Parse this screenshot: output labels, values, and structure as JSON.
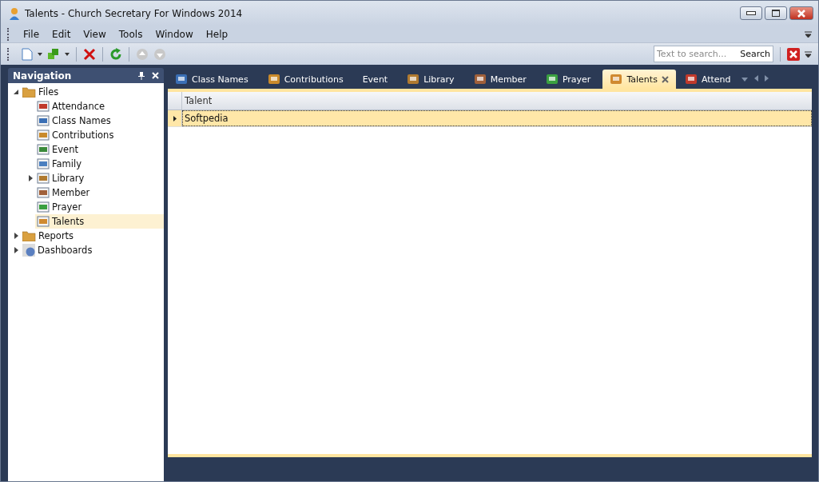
{
  "window": {
    "title": "Talents - Church Secretary For Windows 2014"
  },
  "menu": [
    "File",
    "Edit",
    "View",
    "Tools",
    "Window",
    "Help"
  ],
  "search": {
    "placeholder": "Text to search...",
    "button": "Search"
  },
  "navigation": {
    "title": "Navigation",
    "items": [
      {
        "label": "Files",
        "expanded": true,
        "selected": false,
        "children": [
          {
            "label": "Attendance",
            "selected": false
          },
          {
            "label": "Class Names",
            "selected": false
          },
          {
            "label": "Contributions",
            "selected": false
          },
          {
            "label": "Event",
            "selected": false
          },
          {
            "label": "Family",
            "selected": false
          },
          {
            "label": "Library",
            "selected": false,
            "expanded": false
          },
          {
            "label": "Member",
            "selected": false
          },
          {
            "label": "Prayer",
            "selected": false
          },
          {
            "label": "Talents",
            "selected": true
          }
        ]
      },
      {
        "label": "Reports",
        "expanded": false,
        "selected": false
      },
      {
        "label": "Dashboards",
        "expanded": false,
        "selected": false
      }
    ]
  },
  "tabs": [
    {
      "label": "Class Names",
      "selected": false
    },
    {
      "label": "Contributions",
      "selected": false
    },
    {
      "label": "Event",
      "selected": false
    },
    {
      "label": "Library",
      "selected": false
    },
    {
      "label": "Member",
      "selected": false
    },
    {
      "label": "Prayer",
      "selected": false
    },
    {
      "label": "Talents",
      "selected": true
    },
    {
      "label": "Attend",
      "selected": false
    }
  ],
  "table": {
    "columns": [
      "Talent"
    ],
    "rows": [
      {
        "cells": [
          "Softpedia"
        ],
        "selected": true
      }
    ]
  }
}
